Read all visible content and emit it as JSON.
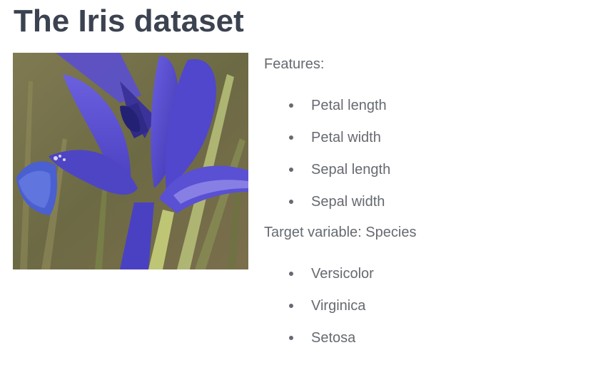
{
  "page": {
    "title": "The Iris dataset"
  },
  "image": {
    "subject": "iris-flower-photo",
    "colors": {
      "petal": "#5a4ed0",
      "petal_dark": "#3d34a8",
      "background": "#6f6a42"
    }
  },
  "features": {
    "heading": "Features:",
    "items": [
      "Petal length",
      "Petal width",
      "Sepal length",
      "Sepal width"
    ]
  },
  "target": {
    "heading": "Target variable: Species",
    "items": [
      "Versicolor",
      "Virginica",
      "Setosa"
    ]
  },
  "colors": {
    "title_text": "#3b4250",
    "body_text": "#666a70"
  }
}
